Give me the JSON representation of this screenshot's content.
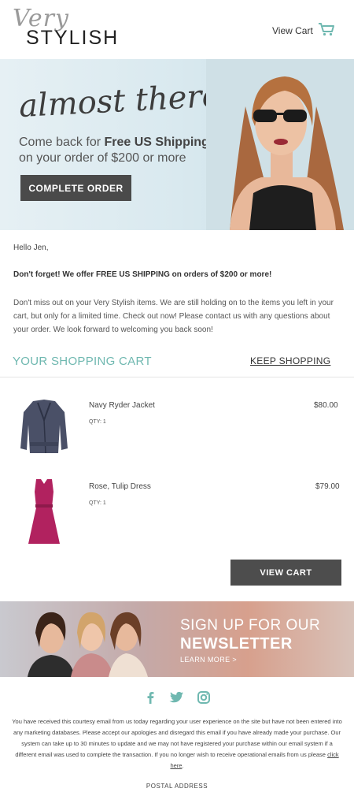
{
  "header": {
    "logo_script": "Very",
    "logo_brand": "STYLISH",
    "view_cart_label": "View Cart",
    "cart_icon": "shopping-cart-icon"
  },
  "hero": {
    "script_text": "almost there!",
    "line1_prefix": "Come back for ",
    "line1_bold": "Free US Shipping",
    "line2": "on your order of $200 or more",
    "button_label": "COMPLETE ORDER"
  },
  "body": {
    "greeting": "Hello Jen,",
    "reminder": "Don't forget! We offer FREE US SHIPPING on orders of $200 or more!",
    "message": "Don't miss out on your Very Stylish items. We are still holding on to the items you left in your cart, but only for a limited time. Check out now!  Please contact us with any questions about your order. We look forward to welcoming you back soon!"
  },
  "cart": {
    "title": "YOUR SHOPPING CART",
    "keep_shopping": "KEEP SHOPPING",
    "items": [
      {
        "name": "Navy Ryder Jacket",
        "qty": "QTY: 1",
        "price": "$80.00"
      },
      {
        "name": "Rose, Tulip Dress",
        "qty": "QTY: 1",
        "price": "$79.00"
      }
    ],
    "view_cart_button": "VIEW CART"
  },
  "newsletter": {
    "line1": "SIGN UP FOR OUR",
    "line2": "NEWSLETTER",
    "learn_more": "LEARN MORE >"
  },
  "social": {
    "icons": [
      "facebook-icon",
      "twitter-icon",
      "instagram-icon"
    ]
  },
  "footer": {
    "disclaimer": "You have received this courtesy email from us today regarding your user experience on the site but have not been entered into any marketing databases. Please accept our apologies and disregard this email if you have already made your purchase. Our system can take up to 30 minutes to update and we may not have registered your purchase within our email system if a different email was used to complete the transaction. If you no longer wish to receive operational emails from us please ",
    "link_text": "click here",
    "link_suffix": ".",
    "postal_address": "POSTAL ADDRESS"
  },
  "colors": {
    "accent_teal": "#6fb8b0",
    "button_dark": "#4a4a4a"
  }
}
